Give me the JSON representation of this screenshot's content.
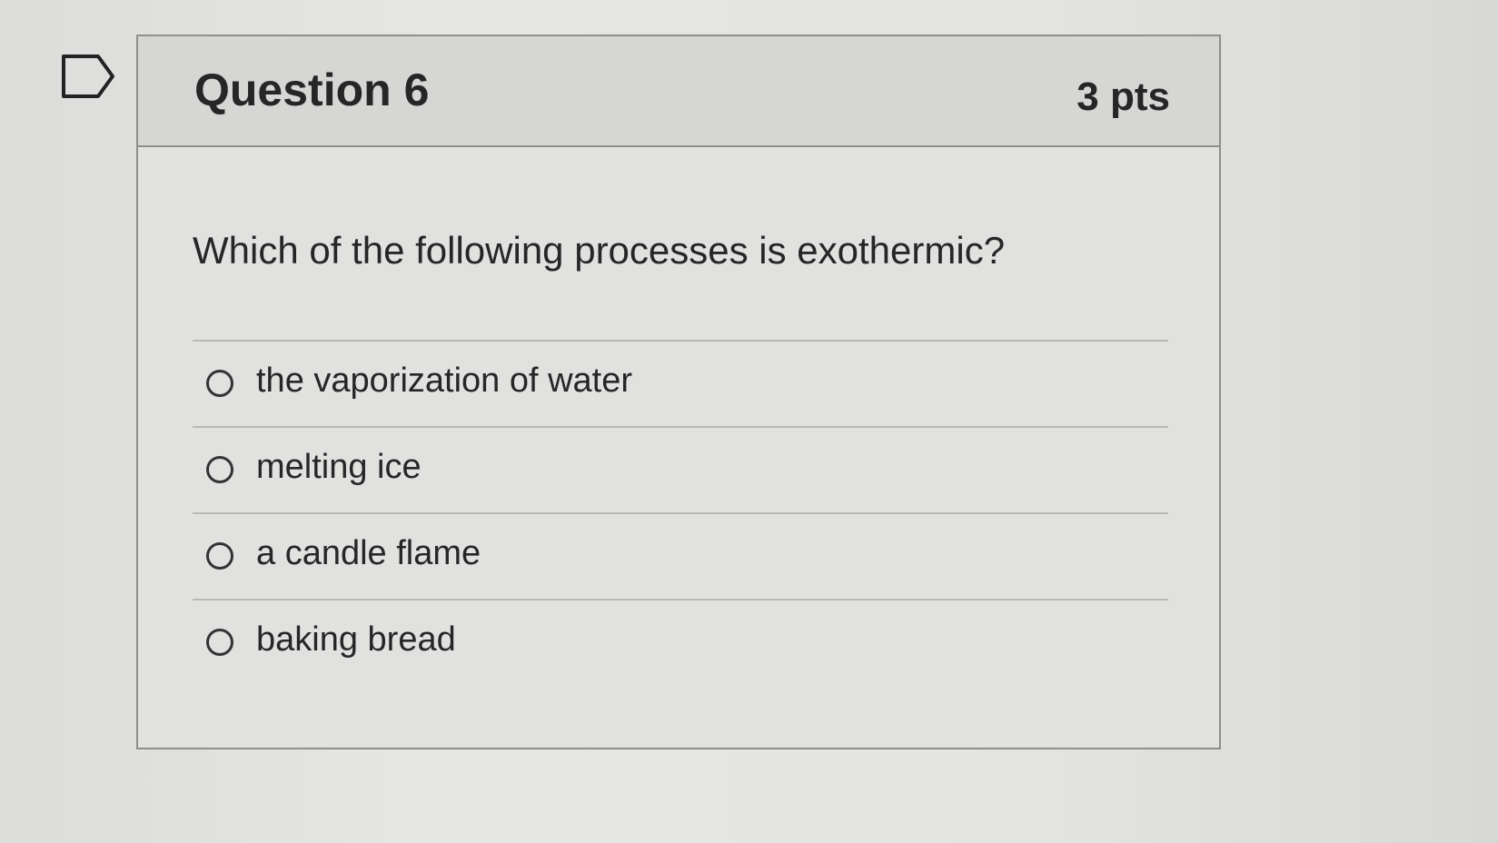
{
  "question": {
    "title": "Question 6",
    "points": "3 pts",
    "text": "Which of the following processes is exothermic?",
    "flag_icon": "flag-outline-icon",
    "answers": [
      {
        "label": "the vaporization of water"
      },
      {
        "label": "melting ice"
      },
      {
        "label": "a candle flame"
      },
      {
        "label": "baking bread"
      }
    ]
  }
}
